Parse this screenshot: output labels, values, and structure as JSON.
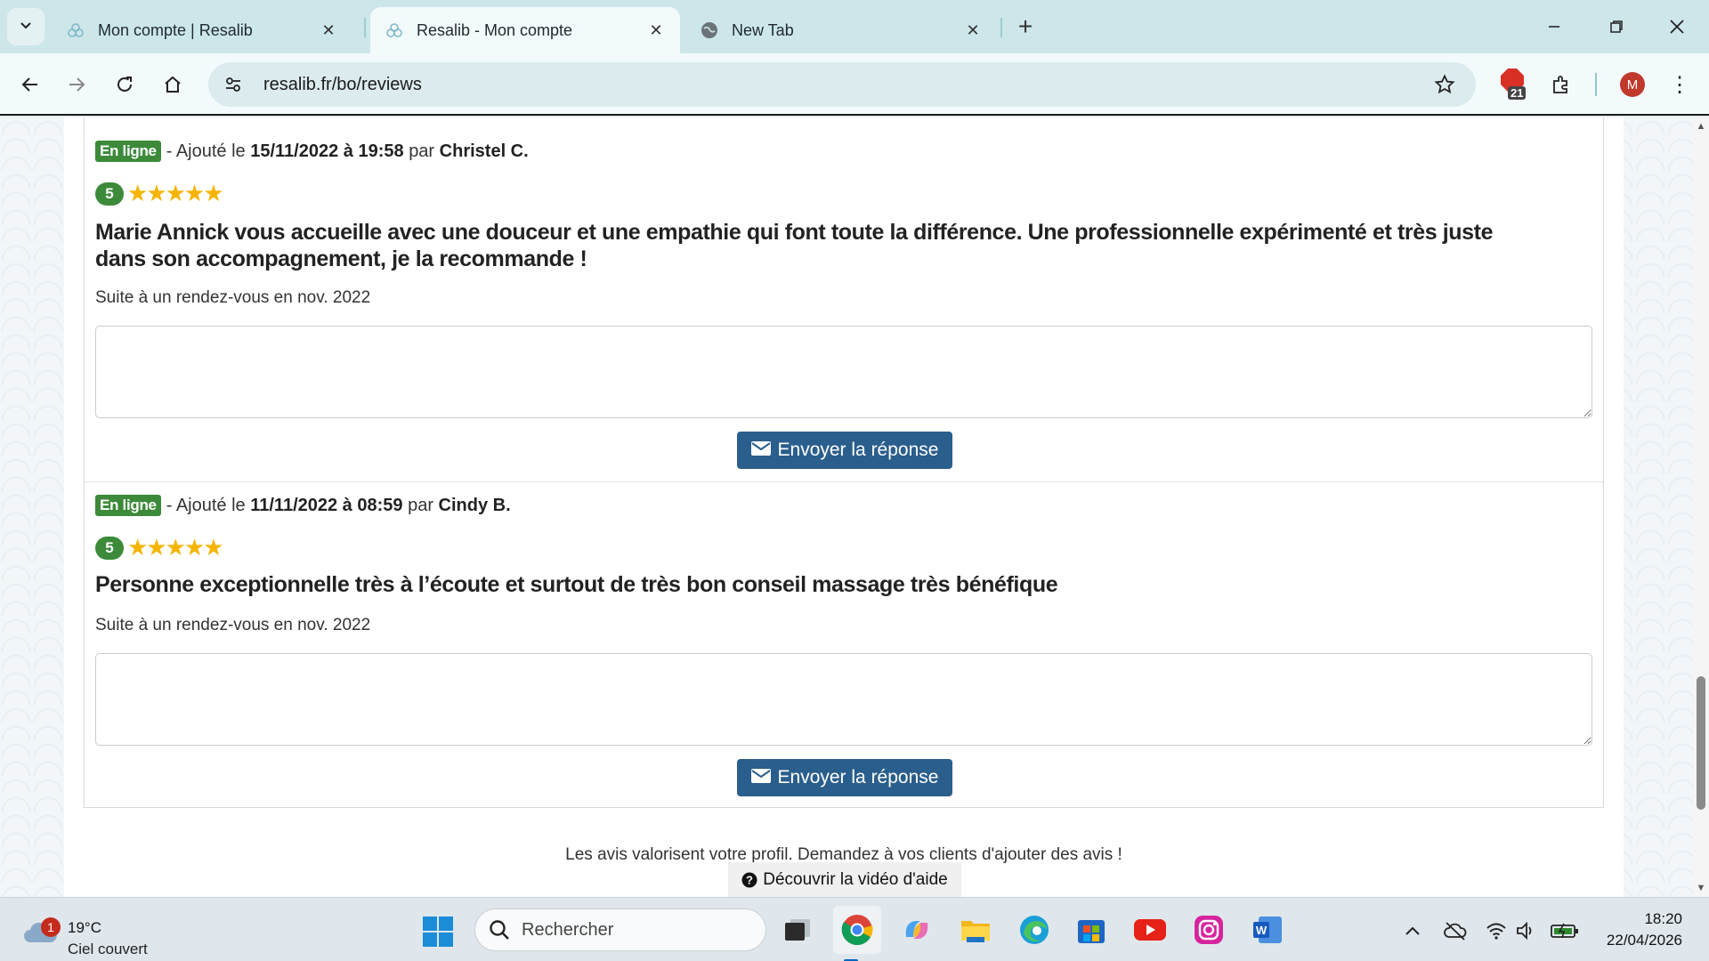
{
  "browser": {
    "tabs": [
      {
        "title": "Mon compte | Resalib",
        "active": false
      },
      {
        "title": "Resalib - Mon compte",
        "active": true
      },
      {
        "title": "New Tab",
        "active": false
      }
    ],
    "url": "resalib.fr/bo/reviews",
    "extension_badge": "21",
    "profile_initial": "M"
  },
  "reviews": [
    {
      "status": "En ligne",
      "added_prefix": "- Ajouté le",
      "date": "15/11/2022 à 19:58",
      "by": "par",
      "author": "Christel C.",
      "score": "5",
      "stars": "★★★★★",
      "text": "Marie Annick vous accueille avec une douceur et une empathie qui font toute la différence. Une professionnelle expérimenté et très juste dans son accompagnement, je la recommande !",
      "after_visit": "Suite à un rendez-vous en nov. 2022",
      "reply_value": "",
      "send_label": "Envoyer la réponse"
    },
    {
      "status": "En ligne",
      "added_prefix": "- Ajouté le",
      "date": "11/11/2022 à 08:59",
      "by": "par",
      "author": "Cindy B.",
      "score": "5",
      "stars": "★★★★★",
      "text": "Personne exceptionnelle très à l’écoute et surtout de très bon conseil massage très bénéfique",
      "after_visit": "Suite à un rendez-vous en nov. 2022",
      "reply_value": "",
      "send_label": "Envoyer la réponse"
    }
  ],
  "footer": {
    "note": "Les avis valorisent votre profil. Demandez à vos clients d'ajouter des avis !",
    "help_video": "Découvrir la vidéo d'aide"
  },
  "taskbar": {
    "weather_badge": "1",
    "temperature": "19°C",
    "condition": "Ciel couvert",
    "search_placeholder": "Rechercher",
    "time": "18:20",
    "date": "22/04/2026"
  },
  "colors": {
    "status_green": "#3c8a3a",
    "button_blue": "#2a5e8c",
    "star_gold": "#f4b400",
    "tabstrip": "#cde6ea"
  }
}
